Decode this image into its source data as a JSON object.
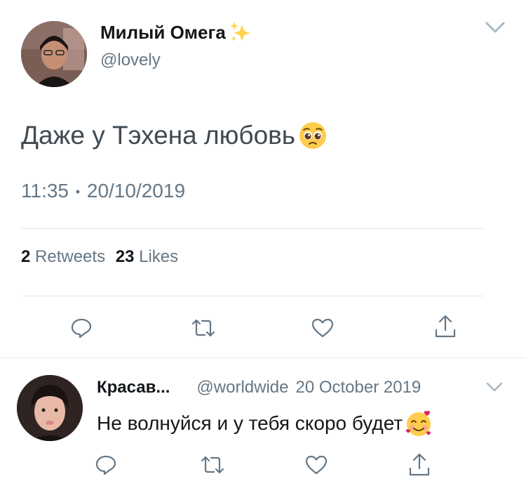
{
  "tweet": {
    "display_name": "Милый Омега",
    "handle": "@lovely",
    "text": "Даже у Тэхена любовь",
    "time": "11:35",
    "separator": "•",
    "date": "20/10/2019",
    "retweets_count": "2",
    "retweets_label": "Retweets",
    "likes_count": "23",
    "likes_label": "Likes"
  },
  "reply": {
    "display_name": "Красав...",
    "handle": "@worldwide",
    "date": "20 October 2019",
    "text": "Не волнуйся и у тебя скоро будет"
  },
  "icons": {
    "name_emoji": "sparkles-icon",
    "text_emoji": "pleading-face-icon",
    "reply_emoji": "smiling-face-with-hearts-icon",
    "menu": "chevron-down-icon",
    "reply": "reply-icon",
    "retweet": "retweet-icon",
    "like": "heart-icon",
    "share": "share-icon"
  },
  "colors": {
    "text": "#14171a",
    "muted": "#657786",
    "divider": "#e1e8ed",
    "emoji_yellow": "#ffcc4d",
    "sparkle": "#ffd34d",
    "heart_red": "#e0245e"
  }
}
